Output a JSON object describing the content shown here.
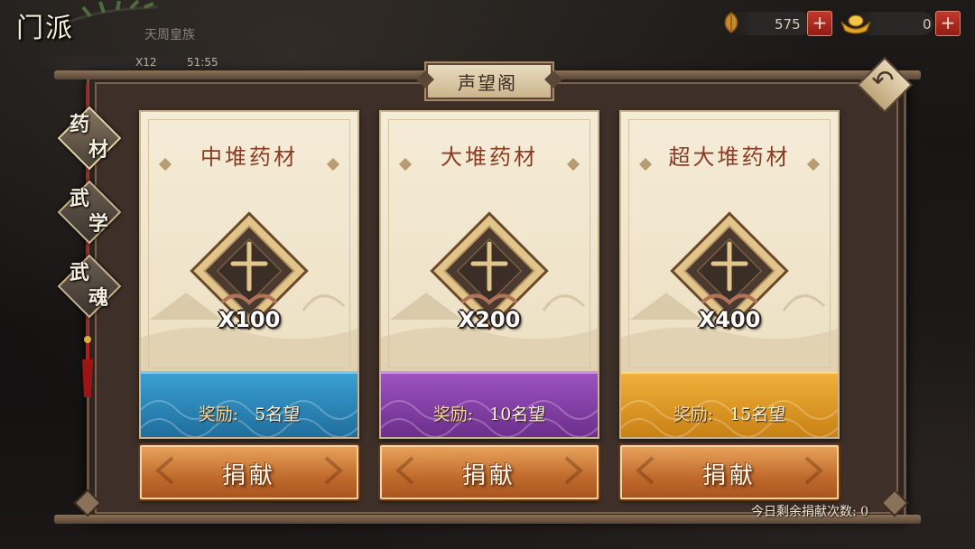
{
  "header": {
    "section_title": "门派",
    "section_subtitle": "天周皇族",
    "multiplier": "X12",
    "timer": "51:55",
    "leaf_currency": "575",
    "gold_currency": "0",
    "plus_label": "+"
  },
  "panel": {
    "title": "声望阁",
    "back_glyph": "↶"
  },
  "side_tabs": [
    {
      "line1": "药",
      "line2": "材",
      "active": true
    },
    {
      "line1": "武",
      "line2": "学",
      "active": false
    },
    {
      "line1": "武",
      "line2": "魂",
      "active": false
    }
  ],
  "cards": [
    {
      "name": "中堆药材",
      "quantity": "X100",
      "reward_label": "奖励:",
      "reward_value": "5名望",
      "reward_color": "#2f86b8",
      "button_label": "捐献"
    },
    {
      "name": "大堆药材",
      "quantity": "X200",
      "reward_label": "奖励:",
      "reward_value": "10名望",
      "reward_color": "#8a42ae",
      "button_label": "捐献"
    },
    {
      "name": "超大堆药材",
      "quantity": "X400",
      "reward_label": "奖励:",
      "reward_value": "15名望",
      "reward_color": "#e39d28",
      "button_label": "捐献"
    }
  ],
  "footer": {
    "remaining_text": "今日剩余捐献次数: 0"
  },
  "colors": {
    "panel_bg": "#3e3028",
    "card_bg": "#f5ecd8",
    "button": "#c06a2c",
    "cord": "#b61c1c"
  }
}
